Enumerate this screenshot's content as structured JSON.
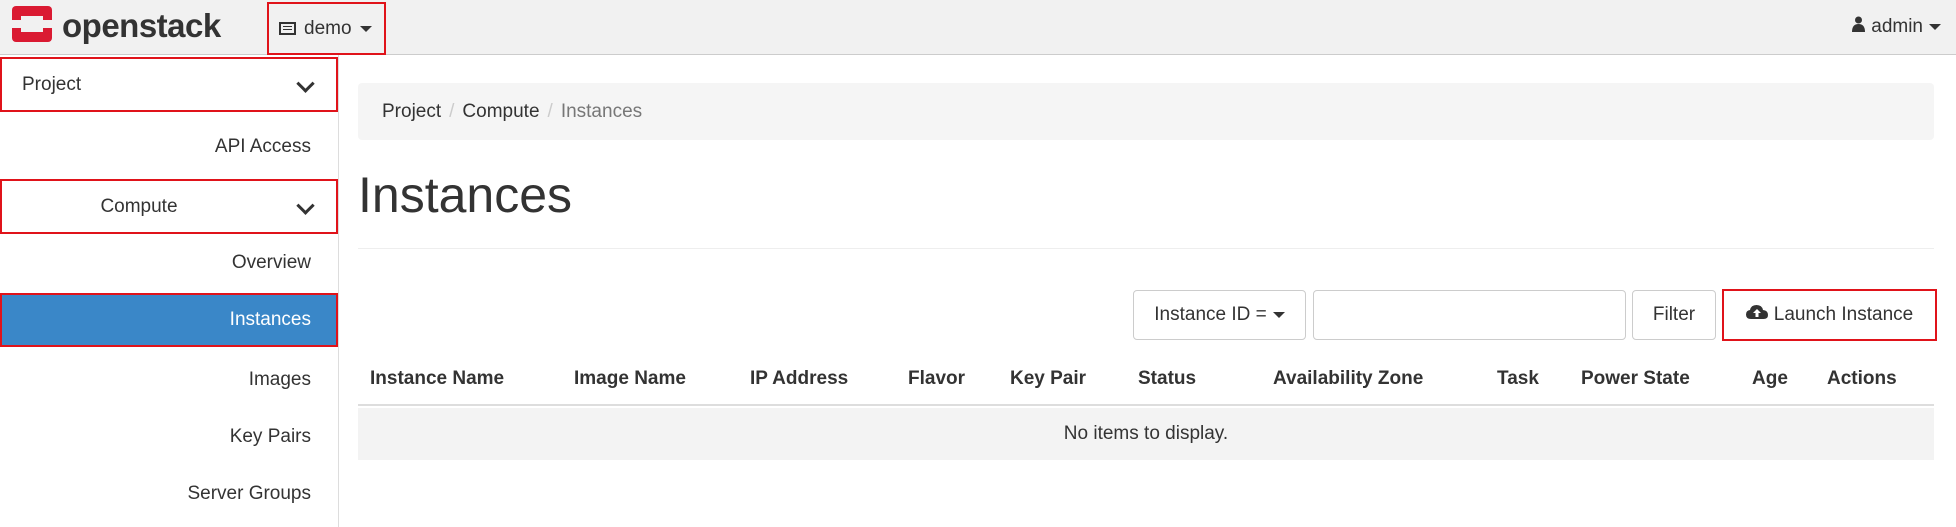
{
  "topbar": {
    "brand": "openstack",
    "project_selector": "demo",
    "user_menu": "admin"
  },
  "sidebar": {
    "project_header": "Project",
    "api_access": "API Access",
    "compute_header": "Compute",
    "items": [
      "Overview",
      "Instances",
      "Images",
      "Key Pairs",
      "Server Groups"
    ],
    "active": "Instances"
  },
  "breadcrumb": [
    "Project",
    "Compute",
    "Instances"
  ],
  "page_title": "Instances",
  "toolbar": {
    "filter_field": "Instance ID =",
    "filter_value": "",
    "filter_button": "Filter",
    "launch_button": "Launch Instance"
  },
  "table": {
    "columns": [
      "Instance Name",
      "Image Name",
      "IP Address",
      "Flavor",
      "Key Pair",
      "Status",
      "Availability Zone",
      "Task",
      "Power State",
      "Age",
      "Actions"
    ],
    "empty_message": "No items to display."
  },
  "colors": {
    "accent": "#3a87c8",
    "highlight_border": "#e0131a",
    "brand_red": "#da1a32"
  },
  "icons": [
    "openstack-logo-icon",
    "project-icon",
    "user-icon",
    "cloud-upload-icon",
    "chevron-down-icon"
  ]
}
